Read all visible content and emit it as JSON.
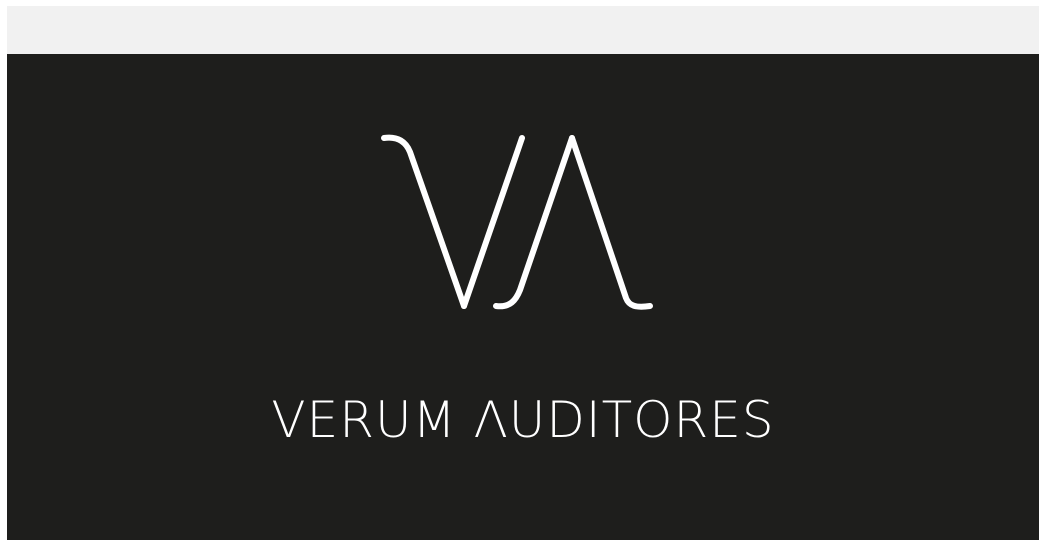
{
  "colors": {
    "top_bar": "#f1f1f1",
    "hero_background": "#1e1e1c",
    "logo": "#ffffff"
  },
  "logo": {
    "icon": "va-monogram-icon",
    "brand_name": "VERUM ΛUDITORES"
  }
}
